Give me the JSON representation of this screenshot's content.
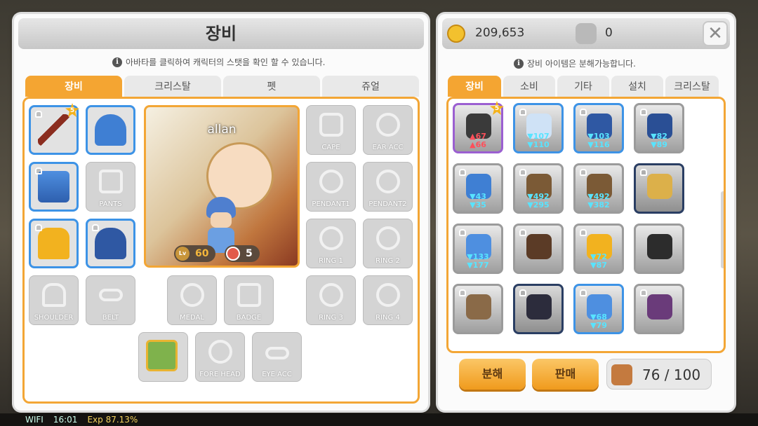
{
  "equipment_panel": {
    "title": "장비",
    "hint": "아바타를 클릭하여 캐릭터의 스탯을 확인 할 수 있습니다.",
    "tabs": [
      "장비",
      "크리스탈",
      "펫",
      "쥬얼"
    ],
    "character": {
      "name": "allan",
      "level": "60",
      "stars": "5"
    },
    "slots": {
      "cape": "CAPE",
      "ear_acc": "EAR ACC",
      "pants": "PANTS",
      "pendant1": "PENDANT1",
      "pendant2": "PENDANT2",
      "ring1": "RING 1",
      "ring2": "RING 2",
      "ring3": "RING 3",
      "ring4": "RING 4",
      "shoulder": "SHOULDER",
      "belt": "BELT",
      "medal": "MEDAL",
      "badge": "BADGE",
      "fore_head": "FORE HEAD",
      "eye_acc": "EYE ACC"
    },
    "weapon_star": "5"
  },
  "inventory_panel": {
    "mesos": "209,653",
    "stars": "0",
    "hint": "장비 아이템은 분해가능합니다.",
    "tabs": [
      "장비",
      "소비",
      "기타",
      "설치",
      "크리스탈"
    ],
    "items": [
      {
        "up": "67",
        "down": "",
        "up2": "66",
        "star": "5"
      },
      {
        "up": "",
        "down": "107",
        "down2": "110"
      },
      {
        "up": "",
        "down": "103",
        "down2": "116"
      },
      {
        "up": "",
        "down": "82",
        "down2": "89"
      },
      {
        "up": "",
        "down": "43",
        "down2": "35"
      },
      {
        "up": "",
        "down": "492",
        "down2": "295"
      },
      {
        "up": "",
        "down": "492",
        "down2": "382"
      },
      {
        "up": "",
        "down": "",
        "down2": ""
      },
      {
        "up": "",
        "down": "133",
        "down2": "177"
      },
      {
        "up": "",
        "down": "",
        "down2": ""
      },
      {
        "up": "",
        "down": "72",
        "down2": "87"
      },
      {
        "up": "",
        "down": "",
        "down2": ""
      },
      {
        "up": "",
        "down": "",
        "down2": ""
      },
      {
        "up": "",
        "down": "",
        "down2": ""
      },
      {
        "up": "",
        "down": "68",
        "down2": "79"
      },
      {
        "up": "",
        "down": "",
        "down2": ""
      }
    ],
    "buttons": {
      "disassemble": "분해",
      "sell": "판매"
    },
    "capacity": "76 / 100"
  },
  "status_bar": {
    "network": "WIFI",
    "time": "16:01",
    "exp": "Exp 87.13%"
  },
  "colors": {
    "accent_orange": "#f4a532",
    "equipped_blue": "#3d93e6"
  }
}
